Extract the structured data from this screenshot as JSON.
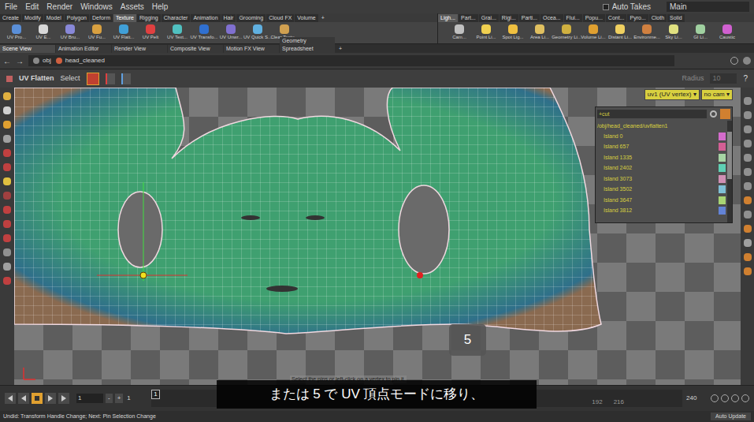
{
  "menu": [
    "File",
    "Edit",
    "Render",
    "Windows",
    "Assets",
    "Help"
  ],
  "auto_takes": {
    "label": "Auto Takes",
    "checked": false
  },
  "desktop": "Main",
  "add_tab": "+",
  "shelf_tabs_left": [
    {
      "label": "Create",
      "selected": false
    },
    {
      "label": "Modify",
      "selected": false
    },
    {
      "label": "Model",
      "selected": false
    },
    {
      "label": "Polygon",
      "selected": false
    },
    {
      "label": "Deform",
      "selected": false
    },
    {
      "label": "Texture",
      "selected": true
    },
    {
      "label": "Rigging",
      "selected": false
    },
    {
      "label": "Character",
      "selected": false
    },
    {
      "label": "Animation",
      "selected": false
    },
    {
      "label": "Hair",
      "selected": false
    },
    {
      "label": "Grooming",
      "selected": false
    },
    {
      "label": "Cloud FX",
      "selected": false
    },
    {
      "label": "Volume",
      "selected": false
    }
  ],
  "shelf_tabs_right": [
    {
      "label": "Ligh...",
      "selected": true
    },
    {
      "label": "Part...",
      "selected": false
    },
    {
      "label": "Grai...",
      "selected": false
    },
    {
      "label": "Rigi...",
      "selected": false
    },
    {
      "label": "Parti...",
      "selected": false
    },
    {
      "label": "Ocea...",
      "selected": false
    },
    {
      "label": "Flui...",
      "selected": false
    },
    {
      "label": "Popu...",
      "selected": false
    },
    {
      "label": "Cont...",
      "selected": false
    },
    {
      "label": "Pyro...",
      "selected": false
    },
    {
      "label": "Cloth",
      "selected": false
    },
    {
      "label": "Solid",
      "selected": false
    }
  ],
  "shelf_tools_left": [
    "UV Pro...",
    "UV E...",
    "UV Bru...",
    "UV Fu...",
    "UV Flatt...",
    "UV Pelt",
    "UV Text...",
    "UV Transfo...",
    "UV Unwr...",
    "UV Quick S...",
    "Clear Textu..."
  ],
  "shelf_tools_right": [
    "Cam...",
    "Point Li...",
    "Spot Lig...",
    "Area Li...",
    "Geometry Li...",
    "Volume Li...",
    "Distant Li...",
    "Environme...",
    "Sky Li...",
    "GI Li...",
    "Caustic"
  ],
  "pane_tabs": [
    {
      "label": "Scene View",
      "selected": true
    },
    {
      "label": "Animation Editor",
      "selected": false
    },
    {
      "label": "Render View",
      "selected": false
    },
    {
      "label": "Composite View",
      "selected": false
    },
    {
      "label": "Motion FX View",
      "selected": false
    },
    {
      "label": "Geometry Spreadsheet",
      "selected": false
    }
  ],
  "path": [
    "obj",
    "head_cleaned"
  ],
  "tool": {
    "name": "UV Flatten",
    "mode": "Select",
    "radius_label": "Radius",
    "radius": "10"
  },
  "viewport": {
    "uv_menu": "uv1 (UV vertex)",
    "cam_menu": "no cam",
    "hint": "Select the pins or left-click on a vertex to pin it.",
    "key": "5"
  },
  "islands_panel": {
    "filter": "+cut",
    "path": "/obj/head_cleaned/uvflatten1",
    "islands": [
      {
        "name": "Island 0",
        "color": "#d46ccc"
      },
      {
        "name": "Island 657",
        "color": "#d45f95"
      },
      {
        "name": "Island 1335",
        "color": "#a6d4a4"
      },
      {
        "name": "Island 2402",
        "color": "#5fd0b4"
      },
      {
        "name": "Island 3073",
        "color": "#d08fb4"
      },
      {
        "name": "Island 3502",
        "color": "#7fbfd6"
      },
      {
        "name": "Island 3647",
        "color": "#a8d474"
      },
      {
        "name": "Island 3812",
        "color": "#6383d6"
      }
    ]
  },
  "timeline": {
    "start": "1",
    "minus": "-",
    "plus": "+",
    "current": "1",
    "marker": "1",
    "ticks": [
      "192",
      "216"
    ],
    "end": "240"
  },
  "subtitle": "または 5 で UV 頂点モードに移り、",
  "status": {
    "message": "Undid: Transform Handle Change; Next: Pin Selection Change",
    "auto_update": "Auto Update"
  }
}
